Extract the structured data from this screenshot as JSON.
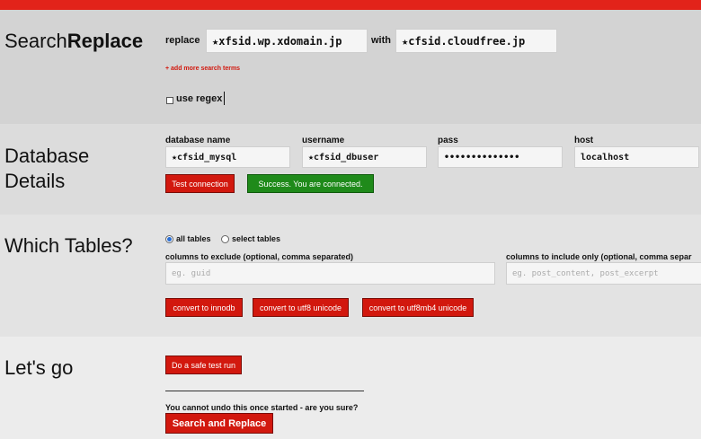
{
  "search_replace": {
    "title_plain": "Search",
    "title_bold": "Replace",
    "replace_label": "replace",
    "replace_value": "★xfsid.wp.xdomain.jp",
    "with_label": "with",
    "with_value": "★cfsid.cloudfree.jp",
    "add_more_link": "+ add more search terms",
    "regex_label": "use regex",
    "regex_checked": false
  },
  "database": {
    "title_line1": "Database",
    "title_line2": "Details",
    "name_label": "database name",
    "name_value": "★cfsid_mysql",
    "user_label": "username",
    "user_value": "★cfsid_dbuser",
    "pass_label": "pass",
    "pass_value": "••••••••••••••",
    "host_label": "host",
    "host_value": "localhost",
    "test_button": "Test connection",
    "status_message": "Success. You are connected."
  },
  "tables": {
    "title": "Which Tables?",
    "radio_all": "all tables",
    "radio_select": "select tables",
    "selected": "all tables",
    "exclude_label": "columns to exclude (optional, comma separated)",
    "exclude_placeholder": "eg. guid",
    "include_label": "columns to include only (optional, comma separ",
    "include_placeholder": "eg. post_content, post_excerpt",
    "btn_innodb": "convert to innodb",
    "btn_utf8": "convert to utf8 unicode",
    "btn_utf8mb4": "convert to utf8mb4 unicode"
  },
  "go": {
    "title": "Let's go",
    "dry_run_button": "Do a safe test run",
    "warning": "You cannot undo this once started - are you sure?",
    "run_button": "Search and Replace"
  },
  "colors": {
    "accent": "#e2231a",
    "button": "#d2180e",
    "success": "#1f8a1a"
  }
}
